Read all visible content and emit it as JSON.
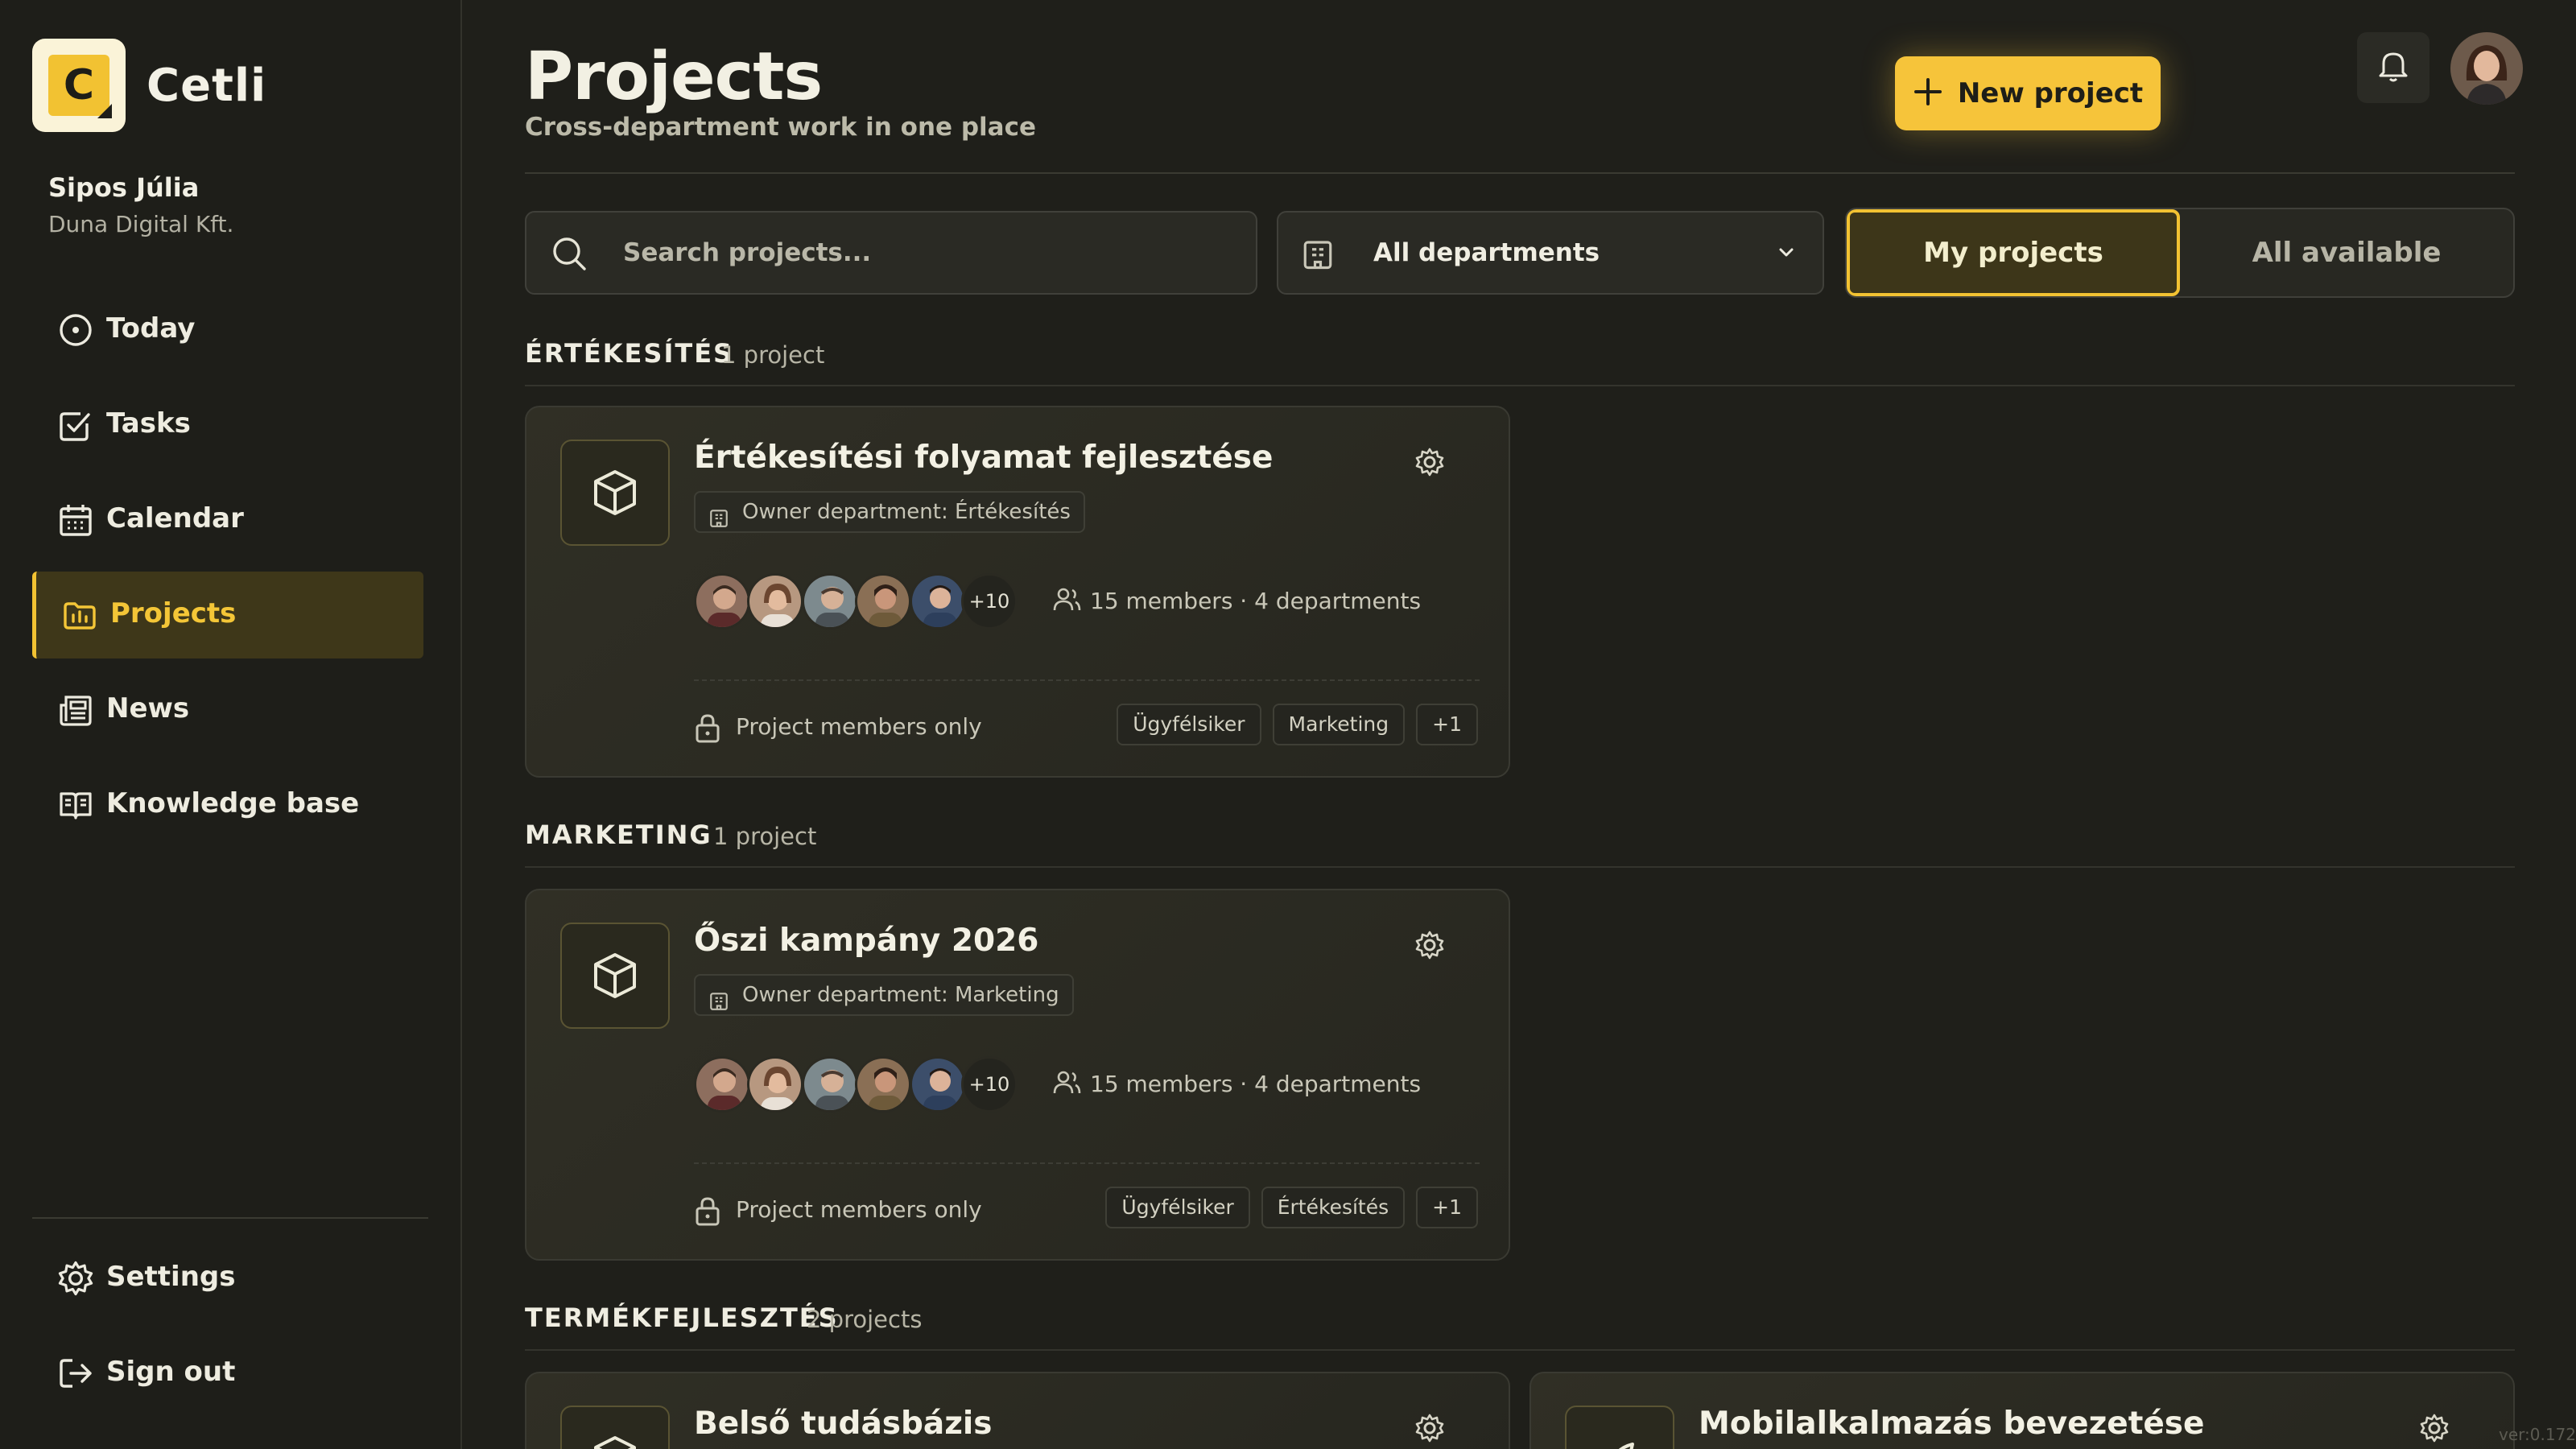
{
  "app": {
    "name": "Cetli",
    "logo_letter": "C"
  },
  "user": {
    "name": "Sipos Júlia",
    "org": "Duna Digital Kft."
  },
  "nav": [
    {
      "id": "today",
      "label": "Today",
      "icon": "clock-icon",
      "active": false
    },
    {
      "id": "tasks",
      "label": "Tasks",
      "icon": "checkbox-icon",
      "active": false
    },
    {
      "id": "calendar",
      "label": "Calendar",
      "icon": "calendar-icon",
      "active": false
    },
    {
      "id": "projects",
      "label": "Projects",
      "icon": "folder-chart-icon",
      "active": true
    },
    {
      "id": "news",
      "label": "News",
      "icon": "newspaper-icon",
      "active": false
    },
    {
      "id": "knowledge",
      "label": "Knowledge base",
      "icon": "book-open-icon",
      "active": false
    }
  ],
  "nav_bottom": [
    {
      "id": "settings",
      "label": "Settings",
      "icon": "gear-icon"
    },
    {
      "id": "signout",
      "label": "Sign out",
      "icon": "logout-icon"
    }
  ],
  "header": {
    "title": "Projects",
    "subtitle": "Cross-department work in one place",
    "new_button": "New project"
  },
  "filters": {
    "search_placeholder": "Search projects...",
    "department": "All departments",
    "scope_options": [
      "My projects",
      "All available"
    ],
    "scope_selected": "My projects"
  },
  "sections": [
    {
      "title": "ÉRTÉKESÍTÉS",
      "count": "1 project",
      "projects": [
        {
          "title": "Értékesítési folyamat fejlesztése",
          "owner": "Owner department: Értékesítés",
          "more_members": "+10",
          "members": "15 members · 4 departments",
          "privacy": "Project members only",
          "tags": [
            "Ügyfélsiker",
            "Marketing",
            "+1"
          ]
        }
      ]
    },
    {
      "title": "MARKETING",
      "count": "1 project",
      "projects": [
        {
          "title": "Őszi kampány 2026",
          "owner": "Owner department: Marketing",
          "more_members": "+10",
          "members": "15 members · 4 departments",
          "privacy": "Project members only",
          "tags": [
            "Ügyfélsiker",
            "Értékesítés",
            "+1"
          ]
        }
      ]
    },
    {
      "title": "TERMÉKFEJLESZTÉS",
      "count": "2 projects",
      "projects": [
        {
          "title": "Belső tudásbázis"
        },
        {
          "title": "Mobilalkalmazás bevezetése"
        }
      ]
    }
  ],
  "version": "ver:0.172",
  "colors": {
    "accent": "#f2c232",
    "background": "#1f1f1a",
    "card": "#2c2b22"
  }
}
